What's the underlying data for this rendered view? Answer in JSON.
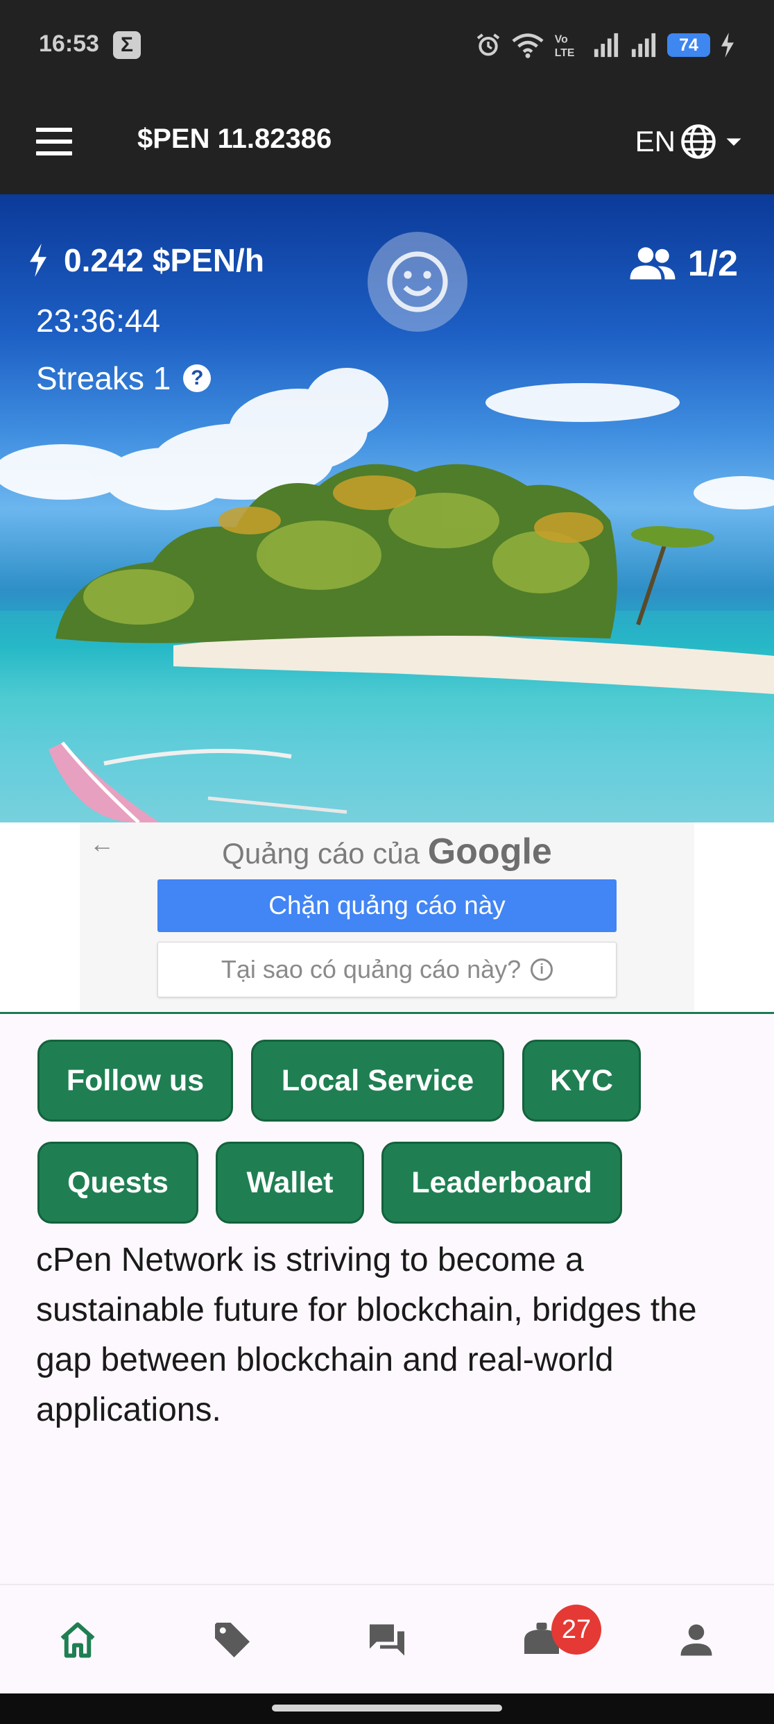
{
  "status_bar": {
    "time": "16:53",
    "battery": "74",
    "icons": [
      "sigma-icon",
      "alarm-icon",
      "wifi-icon",
      "volte-icon",
      "signal-icon",
      "signal-icon",
      "battery-icon",
      "charging-icon"
    ]
  },
  "app_bar": {
    "title": "$PEN 11.82386",
    "language": "EN"
  },
  "hero": {
    "rate": "0.242 $PEN/h",
    "countdown": "23:36:44",
    "streaks": "Streaks 1",
    "referrals": "1/2"
  },
  "ad": {
    "title_prefix": "Quảng cáo của",
    "title_brand": "Google",
    "block_label": "Chặn quảng cáo này",
    "why_label": "Tại sao có quảng cáo này?"
  },
  "chips": {
    "follow_us": "Follow us",
    "local_service": "Local Service",
    "kyc": "KYC",
    "quests": "Quests",
    "wallet": "Wallet",
    "leaderboard": "Leaderboard"
  },
  "description": "cPen Network is striving to become a sustainable future for blockchain, bridges the gap between blockchain and real-world applications.",
  "bottom_nav": {
    "items": [
      "home-icon",
      "tag-icon",
      "chat-icon",
      "notification-icon",
      "profile-icon"
    ],
    "badge": "27"
  },
  "colors": {
    "accent_green": "#1f7f52",
    "app_bar_bg": "#222222",
    "ad_button_blue": "#4285f4",
    "badge_red": "#e53935"
  }
}
